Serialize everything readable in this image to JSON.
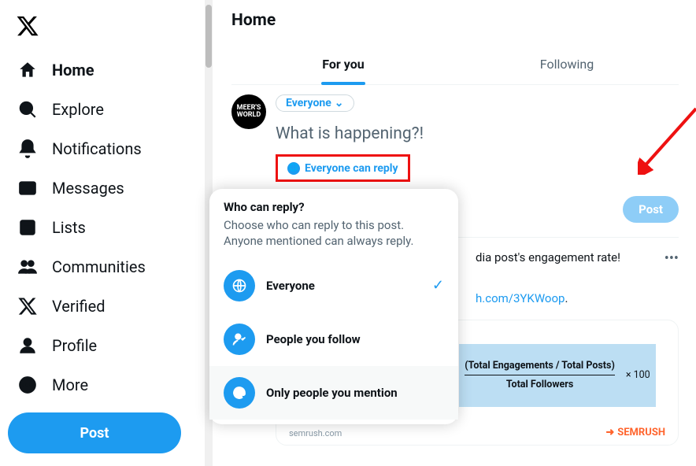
{
  "sidebar": {
    "items": [
      {
        "label": "Home"
      },
      {
        "label": "Explore"
      },
      {
        "label": "Notifications"
      },
      {
        "label": "Messages"
      },
      {
        "label": "Lists"
      },
      {
        "label": "Communities"
      },
      {
        "label": "Verified"
      },
      {
        "label": "Profile"
      },
      {
        "label": "More"
      }
    ],
    "post_button": "Post"
  },
  "header": {
    "title": "Home"
  },
  "tabs": {
    "for_you": "For you",
    "following": "Following"
  },
  "compose": {
    "avatar_text": "MEER'S WORLD",
    "audience": "Everyone",
    "placeholder": "What is happening?!",
    "reply_pill": "Everyone can reply",
    "post_label": "Post"
  },
  "popup": {
    "title": "Who can reply?",
    "subtitle": "Choose who can reply to this post. Anyone mentioned can always reply.",
    "options": [
      {
        "label": "Everyone"
      },
      {
        "label": "People you follow"
      },
      {
        "label": "Only people you mention"
      }
    ]
  },
  "feed": {
    "snippet": "dia post's engagement rate!",
    "link": "h.com/3YKWoop",
    "dot": ".",
    "card": {
      "formula_top": "(Total Engagements / Total Posts)",
      "formula_bottom": "Total Followers",
      "multiply": "× 100",
      "footer_left": "semrush.com",
      "footer_right": "SEMRUSH"
    }
  }
}
